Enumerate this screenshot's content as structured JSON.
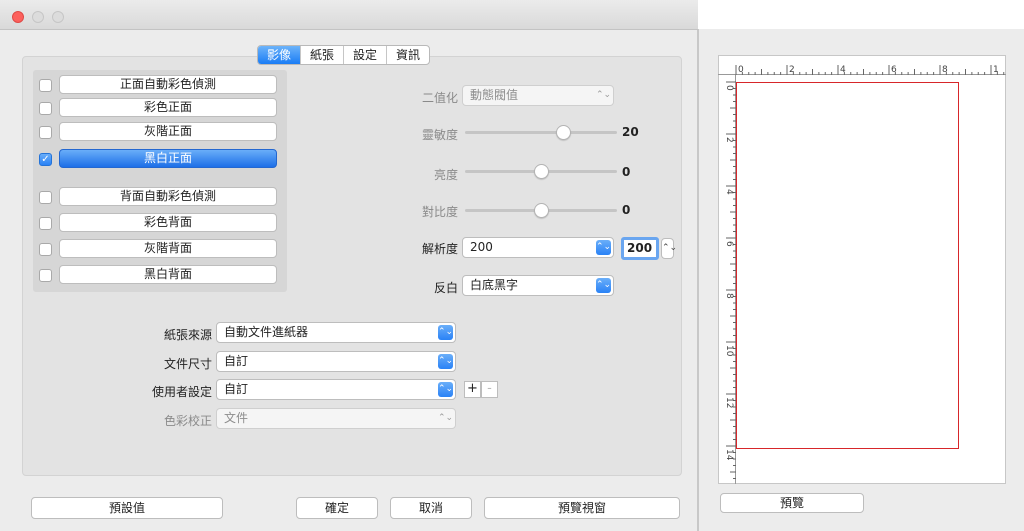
{
  "tabs": [
    {
      "label": "影像",
      "active": true
    },
    {
      "label": "紙張",
      "active": false
    },
    {
      "label": "設定",
      "active": false
    },
    {
      "label": "資訊",
      "active": false
    }
  ],
  "modes": [
    {
      "label": "正面自動彩色偵測",
      "checked": false,
      "selected": false
    },
    {
      "label": "彩色正面",
      "checked": false,
      "selected": false
    },
    {
      "label": "灰階正面",
      "checked": false,
      "selected": false
    },
    {
      "label": "黑白正面",
      "checked": true,
      "selected": true
    },
    {
      "label": "背面自動彩色偵測",
      "checked": false,
      "selected": false
    },
    {
      "label": "彩色背面",
      "checked": false,
      "selected": false
    },
    {
      "label": "灰階背面",
      "checked": false,
      "selected": false
    },
    {
      "label": "黑白背面",
      "checked": false,
      "selected": false
    }
  ],
  "binarization": {
    "label": "二值化",
    "value": "動態閥值"
  },
  "sensitivity": {
    "label": "靈敏度",
    "value": "20",
    "level": 0.65
  },
  "brightness": {
    "label": "亮度",
    "value": "0",
    "level": 0.5
  },
  "contrast": {
    "label": "對比度",
    "value": "0",
    "level": 0.5
  },
  "resolution": {
    "label": "解析度",
    "value": "200",
    "field_value": "200"
  },
  "invert": {
    "label": "反白",
    "value": "白底黑字"
  },
  "paper_source": {
    "label": "紙張來源",
    "value": "自動文件進紙器"
  },
  "document_size": {
    "label": "文件尺寸",
    "value": "自訂"
  },
  "user_settings": {
    "label": "使用者設定",
    "value": "自訂",
    "add": "+",
    "remove": "-"
  },
  "color_matching": {
    "label": "色彩校正",
    "value": "文件"
  },
  "buttons": {
    "defaults": "預設值",
    "ok": "確定",
    "cancel": "取消",
    "preview_window": "預覽視窗"
  },
  "preview": {
    "button": "預覽",
    "ruler_h": [
      "0",
      "2",
      "4",
      "6",
      "8",
      "1"
    ],
    "ruler_v": [
      "0",
      "2",
      "4",
      "6",
      "8",
      "10",
      "12",
      "14"
    ]
  },
  "colors": {
    "accent": "#1d6fe8",
    "scan_outline": "#d7262a",
    "close_button": "#fc605c"
  }
}
